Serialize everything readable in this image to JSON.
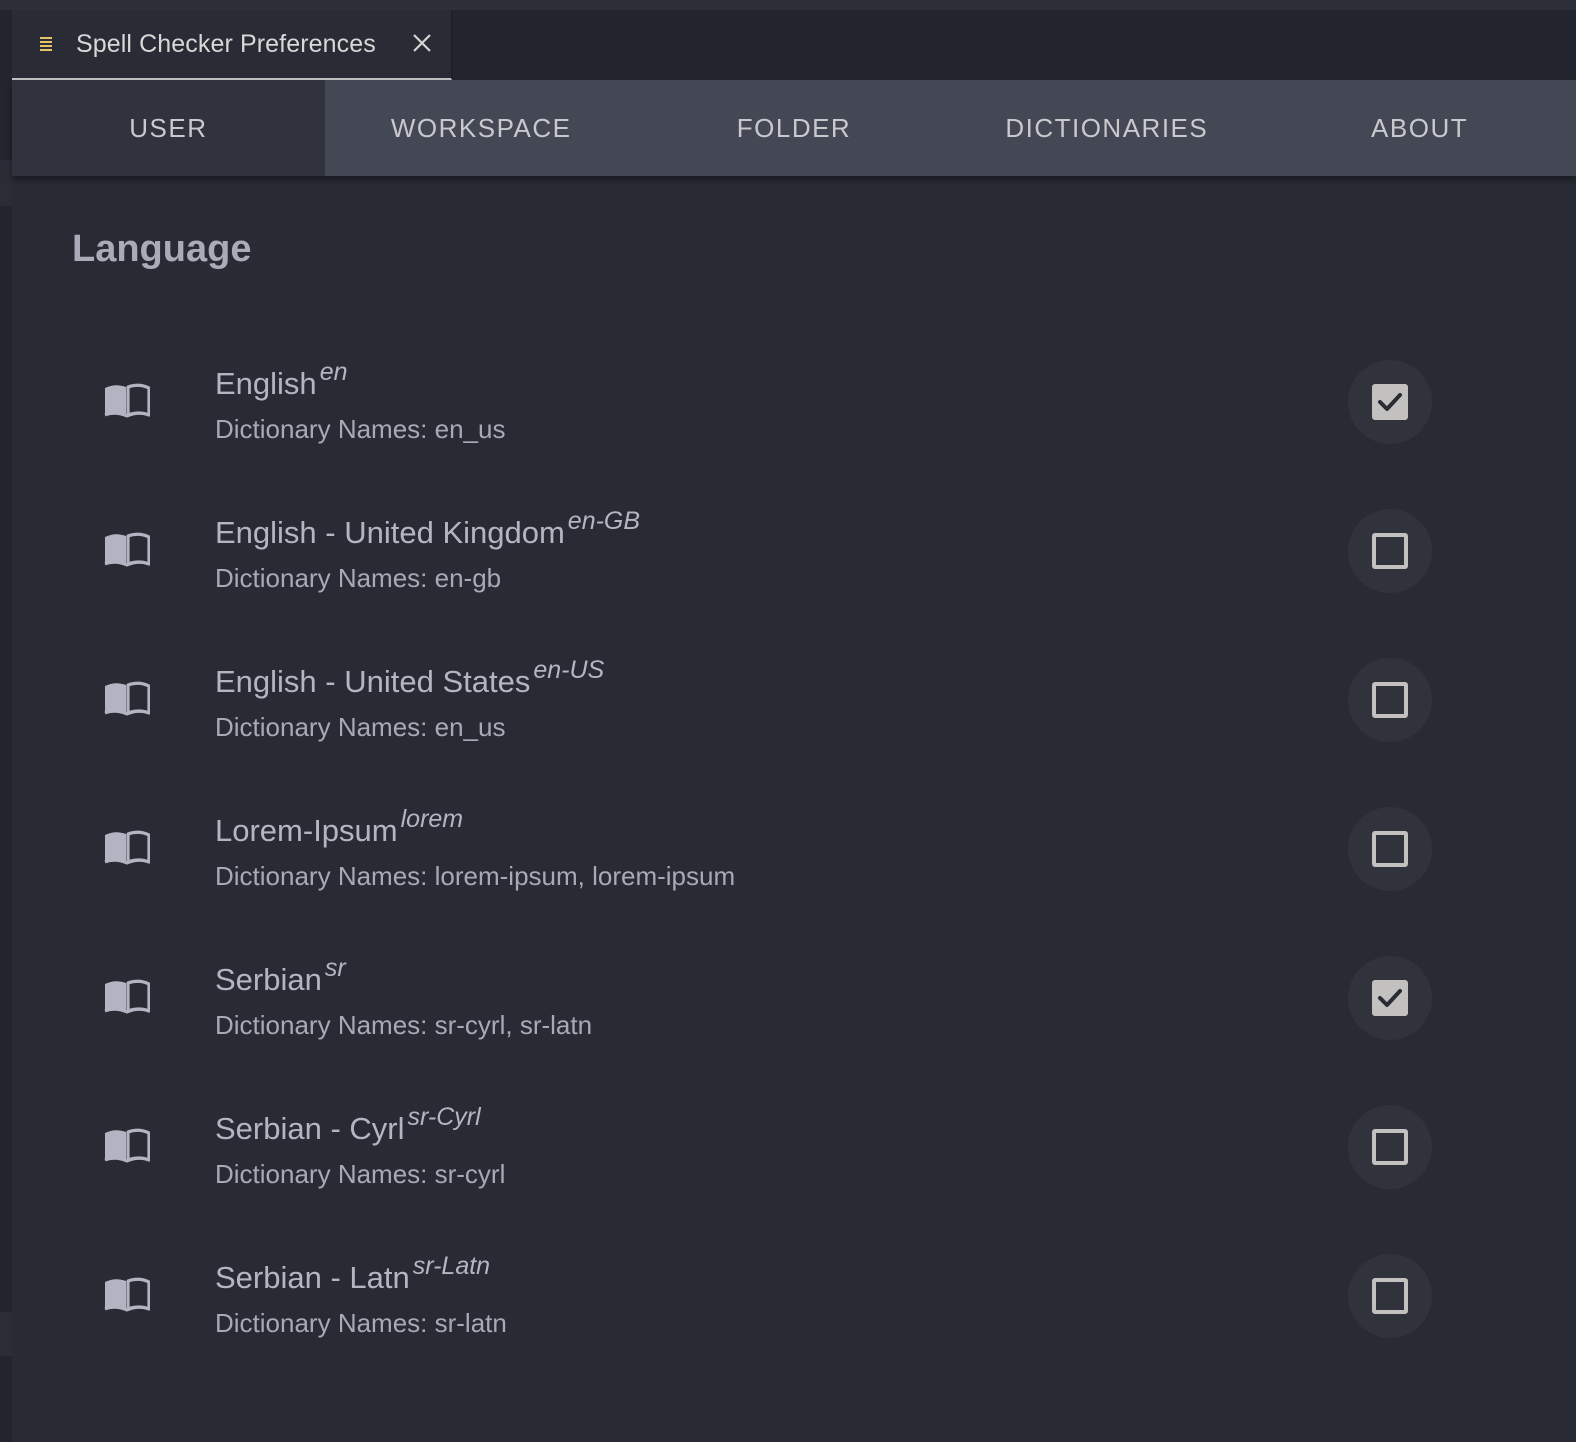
{
  "editor_tab": {
    "title": "Spell Checker Preferences",
    "icon": "list-icon",
    "close_icon": "close-icon",
    "icon_color": "#e8c266"
  },
  "nav": {
    "tabs": [
      {
        "label": "USER",
        "active": true
      },
      {
        "label": "WORKSPACE",
        "active": false
      },
      {
        "label": "FOLDER",
        "active": false
      },
      {
        "label": "DICTIONARIES",
        "active": false
      },
      {
        "label": "ABOUT",
        "active": false
      }
    ]
  },
  "section": {
    "title": "Language"
  },
  "languages": [
    {
      "name": "English",
      "code": "en",
      "dictionaries": "Dictionary Names: en_us",
      "checked": true,
      "icon": "book-open-icon"
    },
    {
      "name": "English - United Kingdom",
      "code": "en-GB",
      "dictionaries": "Dictionary Names: en-gb",
      "checked": false,
      "icon": "book-open-icon"
    },
    {
      "name": "English - United States",
      "code": "en-US",
      "dictionaries": "Dictionary Names: en_us",
      "checked": false,
      "icon": "book-open-icon"
    },
    {
      "name": "Lorem-Ipsum",
      "code": "lorem",
      "dictionaries": "Dictionary Names: lorem-ipsum, lorem-ipsum",
      "checked": false,
      "icon": "book-open-icon"
    },
    {
      "name": "Serbian",
      "code": "sr",
      "dictionaries": "Dictionary Names: sr-cyrl, sr-latn",
      "checked": true,
      "icon": "book-open-icon"
    },
    {
      "name": "Serbian - Cyrl",
      "code": "sr-Cyrl",
      "dictionaries": "Dictionary Names: sr-cyrl",
      "checked": false,
      "icon": "book-open-icon"
    },
    {
      "name": "Serbian - Latn",
      "code": "sr-Latn",
      "dictionaries": "Dictionary Names: sr-latn",
      "checked": false,
      "icon": "book-open-icon"
    }
  ]
}
